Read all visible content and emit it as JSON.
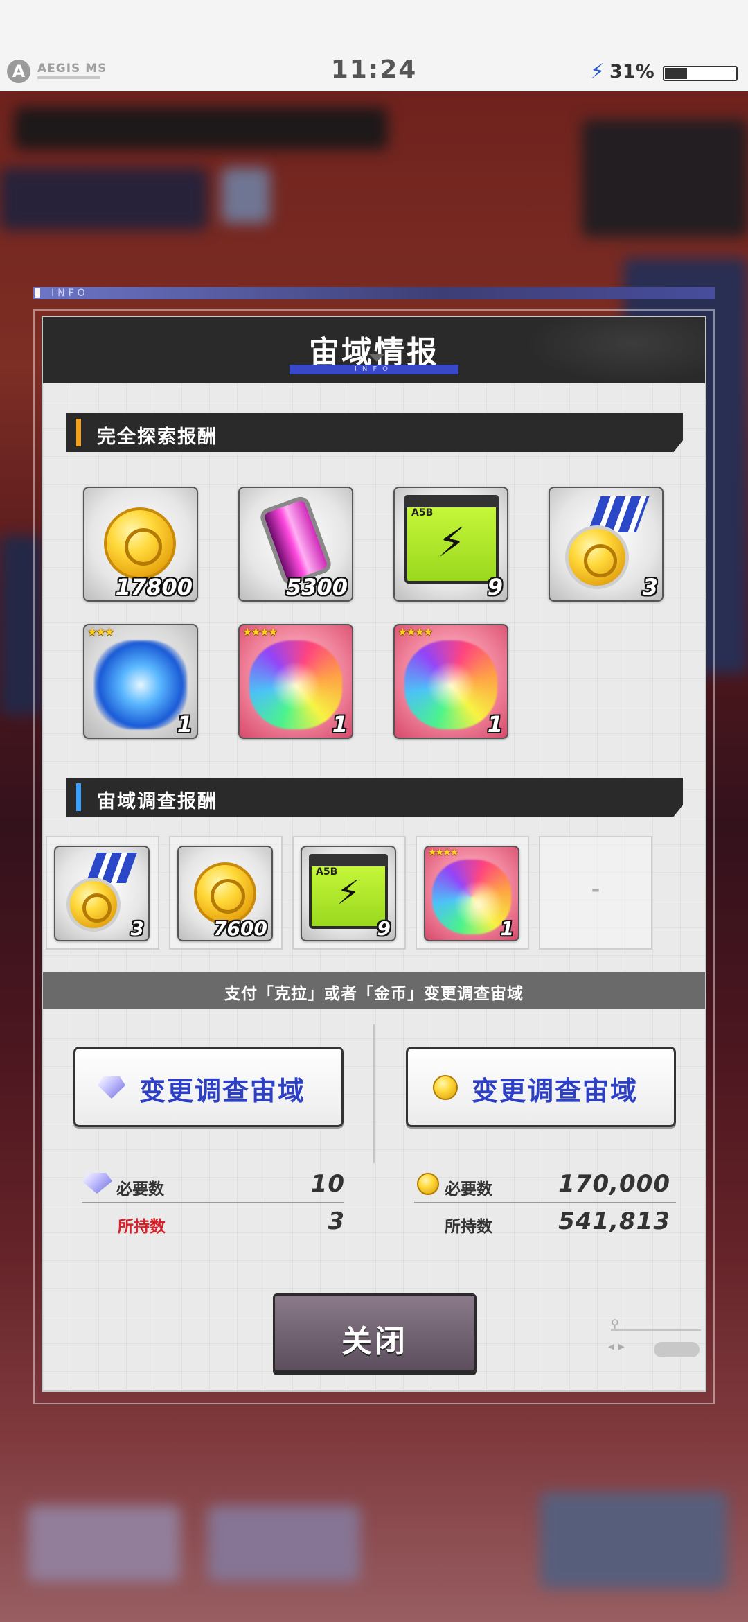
{
  "status_bar": {
    "brand": "AEGIS MS",
    "time": "11:24",
    "battery_text": "31%",
    "battery_level": 0.31
  },
  "info_strip": {
    "label": "INFO"
  },
  "dialog": {
    "title": "宙域情报",
    "title_sub": "INFO",
    "section1": {
      "label": "完全探索报酬",
      "accent_color": "#f2a21a",
      "rewards": [
        {
          "icon": "gold-coin-icon",
          "qty": "17800"
        },
        {
          "icon": "energy-tube-icon",
          "qty": "5300"
        },
        {
          "icon": "battery-icon",
          "qty": "9"
        },
        {
          "icon": "medal-icon",
          "qty": "3"
        },
        {
          "icon": "blue-aura-icon",
          "qty": "1",
          "stars": "★★★"
        },
        {
          "icon": "rainbow-aura-icon",
          "qty": "1",
          "stars": "★★★★"
        },
        {
          "icon": "rainbow-aura-icon",
          "qty": "1",
          "stars": "★★★★"
        }
      ]
    },
    "section2": {
      "label": "宙域调查报酬",
      "accent_color": "#3aa0ff",
      "rewards": [
        {
          "icon": "medal-icon",
          "qty": "3"
        },
        {
          "icon": "gold-coin-icon",
          "qty": "7600"
        },
        {
          "icon": "battery-icon",
          "qty": "9"
        },
        {
          "icon": "rainbow-aura-icon",
          "qty": "1",
          "stars": "★★★★"
        }
      ],
      "empty_slot": "-"
    },
    "change_bar_text": "支付「克拉」或者「金币」变更调查宙域",
    "left_option": {
      "button_label": "变更调查宙域",
      "currency_icon": "crystal-gem-icon",
      "required_label": "必要数",
      "required_value": "10",
      "owned_label": "所持数",
      "owned_value": "3",
      "owned_label_color": "#d8202a"
    },
    "right_option": {
      "button_label": "变更调查宙域",
      "currency_icon": "gold-coin-icon",
      "required_label": "必要数",
      "required_value": "170,000",
      "owned_label": "所持数",
      "owned_value": "541,813"
    },
    "close_label": "关闭"
  }
}
